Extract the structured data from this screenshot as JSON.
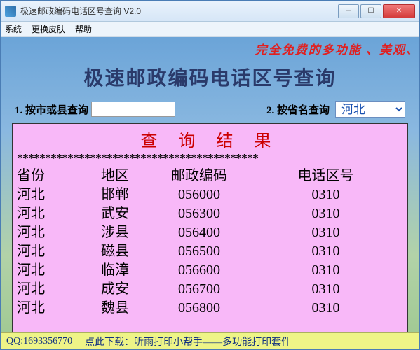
{
  "window": {
    "title": "极速邮政编码电话区号查询 V2.0"
  },
  "menu": {
    "system": "系统",
    "skin": "更换皮肤",
    "help": "帮助"
  },
  "banner": "完全免费的多功能 、美观、",
  "heading": "极速邮政编码电话区号查询",
  "search": {
    "label1": "1. 按市或县查询",
    "input1_value": "",
    "label2": "2. 按省名查询",
    "province_selected": "河北"
  },
  "results": {
    "title": "查 询 结 果",
    "stars": "*******************************************",
    "headers": {
      "province": "省份",
      "area": "地区",
      "postal": "邮政编码",
      "areacode": "电话区号"
    },
    "rows": [
      {
        "province": "河北",
        "area": "邯郸",
        "postal": "056000",
        "areacode": "0310"
      },
      {
        "province": "河北",
        "area": "武安",
        "postal": "056300",
        "areacode": "0310"
      },
      {
        "province": "河北",
        "area": "涉县",
        "postal": "056400",
        "areacode": "0310"
      },
      {
        "province": "河北",
        "area": "磁县",
        "postal": "056500",
        "areacode": "0310"
      },
      {
        "province": "河北",
        "area": "临漳",
        "postal": "056600",
        "areacode": "0310"
      },
      {
        "province": "河北",
        "area": "成安",
        "postal": "056700",
        "areacode": "0310"
      },
      {
        "province": "河北",
        "area": "魏县",
        "postal": "056800",
        "areacode": "0310"
      }
    ]
  },
  "footer": {
    "qq": "QQ:1693356770",
    "download_label": "点此下载：",
    "download_text": "听雨打印小帮手——多功能打印套件"
  }
}
